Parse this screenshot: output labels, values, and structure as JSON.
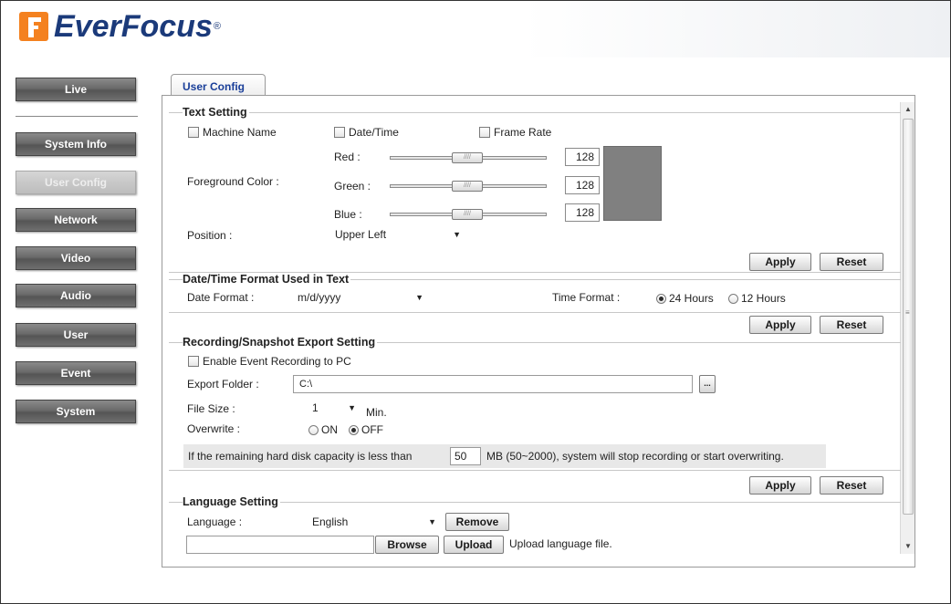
{
  "brand": {
    "name": "EverFocus",
    "reg": "®"
  },
  "sidebar": {
    "items": [
      {
        "label": "Live"
      },
      {
        "label": "System Info"
      },
      {
        "label": "User Config"
      },
      {
        "label": "Network"
      },
      {
        "label": "Video"
      },
      {
        "label": "Audio"
      },
      {
        "label": "User"
      },
      {
        "label": "Event"
      },
      {
        "label": "System"
      }
    ],
    "active": "User Config"
  },
  "tab": {
    "label": "User Config"
  },
  "text_setting": {
    "title": "Text Setting",
    "machine_name": {
      "label": "Machine Name",
      "checked": false
    },
    "date_time": {
      "label": "Date/Time",
      "checked": false
    },
    "frame_rate": {
      "label": "Frame Rate",
      "checked": false
    },
    "fg_color_label": "Foreground Color :",
    "red": {
      "label": "Red :",
      "value": "128"
    },
    "green": {
      "label": "Green :",
      "value": "128"
    },
    "blue": {
      "label": "Blue :",
      "value": "128"
    },
    "swatch_color": "#808080",
    "position_label": "Position :",
    "position_value": "Upper Left",
    "apply": "Apply",
    "reset": "Reset"
  },
  "datetime_format": {
    "title": "Date/Time Format Used in Text",
    "date_format_label": "Date Format :",
    "date_format_value": "m/d/yyyy",
    "time_format_label": "Time Format :",
    "opt_24": "24 Hours",
    "opt_12": "12 Hours",
    "selected": "24 Hours",
    "apply": "Apply",
    "reset": "Reset"
  },
  "export": {
    "title": "Recording/Snapshot Export Setting",
    "enable_label": "Enable Event Recording to PC",
    "enable_checked": false,
    "folder_label": "Export Folder :",
    "folder_value": "C:\\",
    "browse_dots": "...",
    "filesize_label": "File Size :",
    "filesize_value": "1",
    "filesize_unit": "Min.",
    "overwrite_label": "Overwrite :",
    "opt_on": "ON",
    "opt_off": "OFF",
    "overwrite_selected": "OFF",
    "capacity_prefix": "If the remaining hard disk capacity is less than",
    "capacity_value": "50",
    "capacity_suffix": "MB (50~2000), system will stop recording or start overwriting.",
    "apply": "Apply",
    "reset": "Reset"
  },
  "language": {
    "title": "Language Setting",
    "language_label": "Language :",
    "language_value": "English",
    "remove": "Remove",
    "browse": "Browse",
    "upload": "Upload",
    "upload_hint": "Upload language file."
  }
}
